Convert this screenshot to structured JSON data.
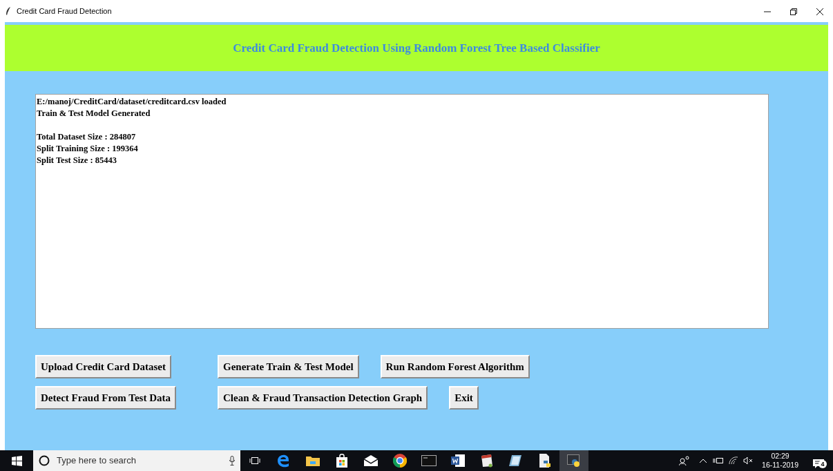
{
  "window": {
    "title": "Credit Card Fraud Detection"
  },
  "header": {
    "title": "Credit Card Fraud Detection Using Random Forest Tree Based Classifier"
  },
  "output": {
    "paragraphs": [
      [
        "E:/manoj/CreditCard/dataset/creditcard.csv loaded",
        "Train & Test Model Generated"
      ],
      [
        "Total Dataset Size : 284807",
        "Split Training Size : 199364",
        "Split Test Size : 85443"
      ]
    ]
  },
  "button_rows": [
    [
      "Upload Credit Card Dataset",
      "Generate Train & Test Model",
      "Run Random Forest Algorithm"
    ],
    [
      "Detect Fraud From Test Data",
      "Clean & Fraud Transaction Detection Graph",
      "Exit"
    ]
  ],
  "taskbar": {
    "search": {
      "placeholder": "Type here to search"
    },
    "time": "02:29",
    "date": "16-11-2019",
    "notification_count": "4"
  }
}
